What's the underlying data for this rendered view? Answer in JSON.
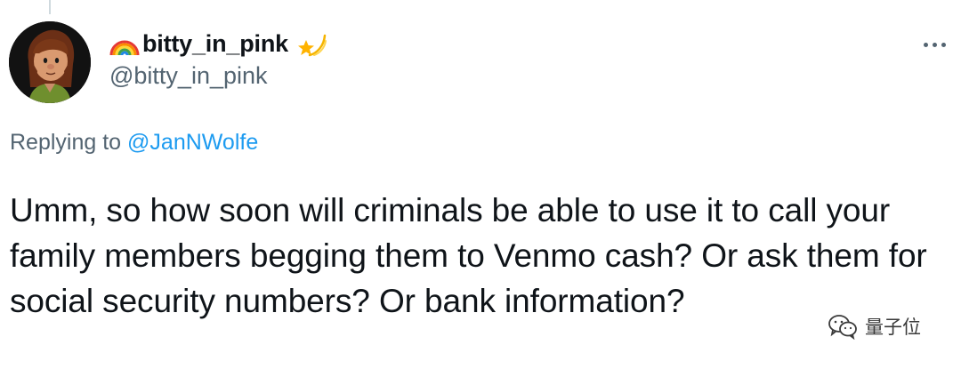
{
  "tweet": {
    "display_name": "bitty_in_pink",
    "name_prefix_emoji": "rainbow-icon",
    "name_suffix_emoji": "shooting-star-icon",
    "handle": "@bitty_in_pink",
    "replying_prefix": "Replying to ",
    "replying_to": "@JanNWolfe",
    "text": "Umm, so how soon will criminals be able to use it to call your family members begging them to Venmo cash? Or ask them for social security numbers? Or bank information?"
  },
  "watermark": {
    "text": "量子位",
    "icon": "wechat-icon"
  },
  "colors": {
    "text_primary": "#0f1419",
    "text_secondary": "#536471",
    "link": "#1d9bf0"
  }
}
